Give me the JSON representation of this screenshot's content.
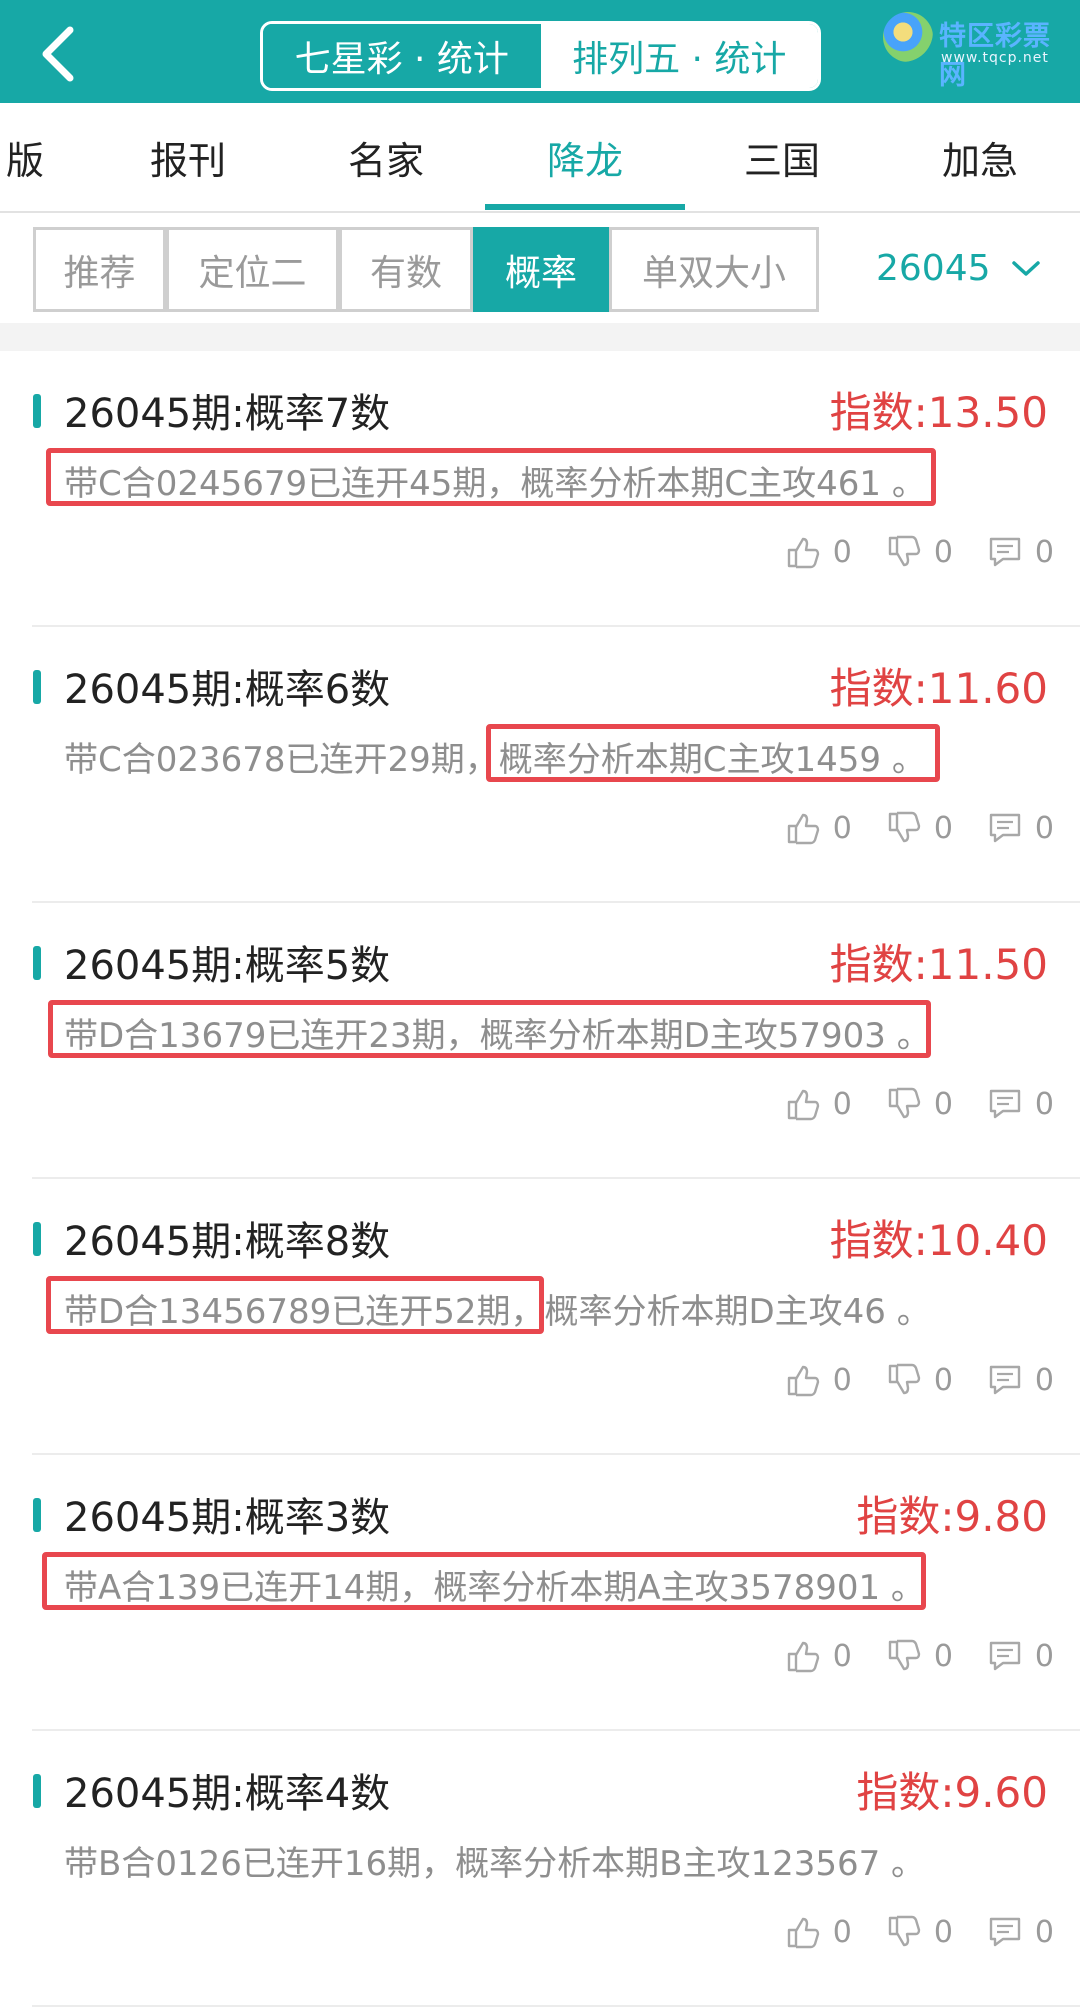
{
  "header": {
    "tabs": [
      {
        "label": "七星彩 · 统计",
        "active": false
      },
      {
        "label": "排列五 · 统计",
        "active": true
      }
    ],
    "watermark": {
      "title": "特区彩票网",
      "url": "www.tqcp.net"
    }
  },
  "categories": {
    "items": [
      "版",
      "报刊",
      "名家",
      "降龙",
      "三国",
      "加急"
    ],
    "active": "降龙"
  },
  "filters": {
    "items": [
      "推荐",
      "定位二",
      "有数",
      "概率",
      "单双大小"
    ],
    "active": "概率",
    "period": "26045"
  },
  "colors": {
    "accent": "#17a8a6",
    "index": "#e04343",
    "highlight": "#e8474e"
  },
  "cards": [
    {
      "title": "26045期:概率7数",
      "index": "指数:13.50",
      "desc": "带C合0245679已连开45期，概率分析本期C主攻461 。",
      "likes": "0",
      "dislikes": "0",
      "comments": "0"
    },
    {
      "title": "26045期:概率6数",
      "index": "指数:11.60",
      "desc": "带C合023678已连开29期，概率分析本期C主攻1459 。",
      "likes": "0",
      "dislikes": "0",
      "comments": "0"
    },
    {
      "title": "26045期:概率5数",
      "index": "指数:11.50",
      "desc": "带D合13679已连开23期，概率分析本期D主攻57903 。",
      "likes": "0",
      "dislikes": "0",
      "comments": "0"
    },
    {
      "title": "26045期:概率8数",
      "index": "指数:10.40",
      "desc": "带D合13456789已连开52期，概率分析本期D主攻46 。",
      "likes": "0",
      "dislikes": "0",
      "comments": "0"
    },
    {
      "title": "26045期:概率3数",
      "index": "指数:9.80",
      "desc": "带A合139已连开14期，概率分析本期A主攻3578901 。",
      "likes": "0",
      "dislikes": "0",
      "comments": "0"
    },
    {
      "title": "26045期:概率4数",
      "index": "指数:9.60",
      "desc": "带B合0126已连开16期，概率分析本期B主攻123567 。",
      "likes": "0",
      "dislikes": "0",
      "comments": "0"
    }
  ]
}
